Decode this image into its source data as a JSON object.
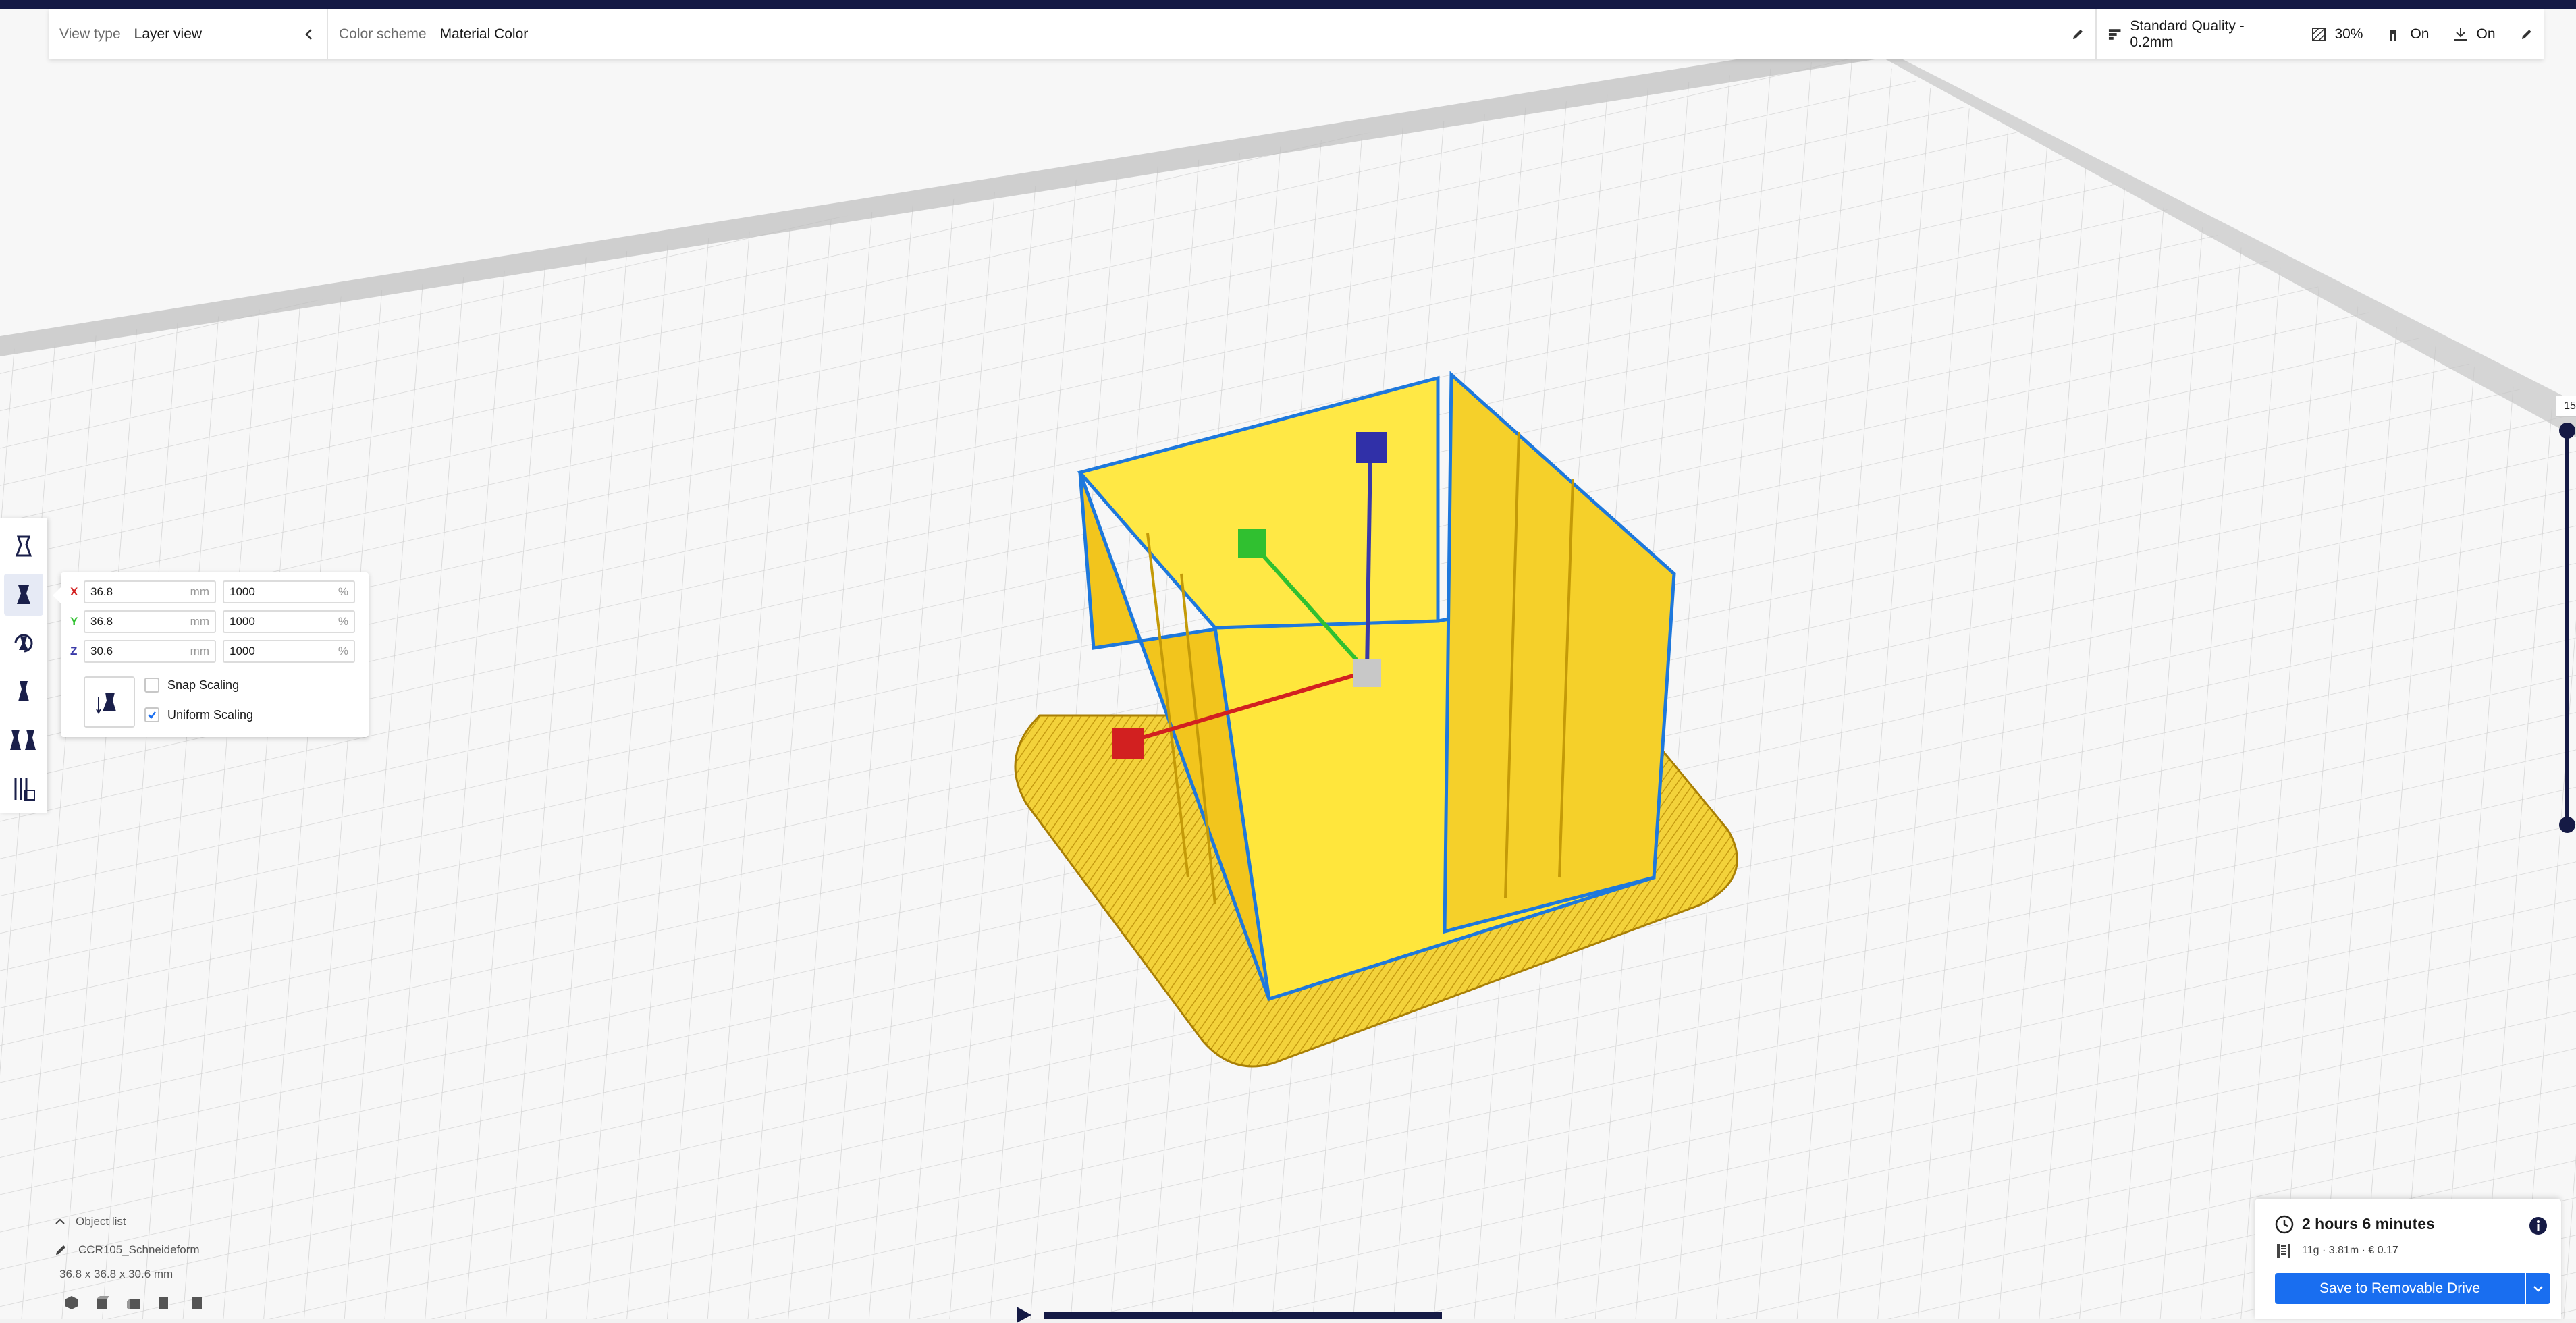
{
  "header": {
    "view_type_label": "View type",
    "view_type_value": "Layer view",
    "color_scheme_label": "Color scheme",
    "color_scheme_value": "Material Color",
    "profile": "Standard Quality - 0.2mm",
    "infill": "30%",
    "support": "On",
    "adhesion": "On"
  },
  "scale_panel": {
    "x": {
      "axis": "X",
      "mm": "36.8",
      "mm_unit": "mm",
      "pct": "1000",
      "pct_unit": "%"
    },
    "y": {
      "axis": "Y",
      "mm": "36.8",
      "mm_unit": "mm",
      "pct": "1000",
      "pct_unit": "%"
    },
    "z": {
      "axis": "Z",
      "mm": "30.6",
      "mm_unit": "mm",
      "pct": "1000",
      "pct_unit": "%"
    },
    "snap_label": "Snap Scaling",
    "snap_checked": false,
    "uniform_label": "Uniform Scaling",
    "uniform_checked": true
  },
  "object_list": {
    "title": "Object list",
    "object_name": "CCR105_Schneideform",
    "dims": "36.8 x 36.8 x 30.6 mm"
  },
  "layer_slider": {
    "top_label": "15"
  },
  "print": {
    "time": "2 hours 6 minutes",
    "material": "11g · 3.81m · € 0.17",
    "save_label": "Save to Removable Drive"
  },
  "colors": {
    "accent": "#196ef0",
    "dark": "#151a45",
    "model": "#ffe63c"
  },
  "icons": [
    "arrow-left-icon",
    "pencil-icon",
    "profile-icon",
    "infill-icon",
    "support-icon",
    "adhesion-icon",
    "move-tool-icon",
    "scale-tool-icon",
    "rotate-tool-icon",
    "mirror-tool-icon",
    "per-model-icon",
    "support-blocker-icon",
    "lay-flat-icon",
    "clock-icon",
    "spool-icon",
    "info-icon",
    "chevron-down-icon"
  ]
}
